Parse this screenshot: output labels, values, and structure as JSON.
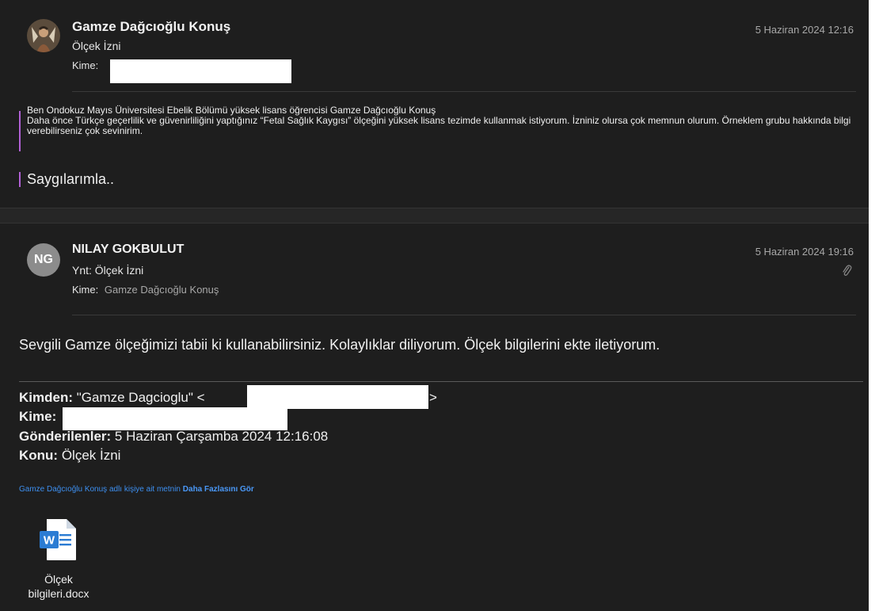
{
  "message1": {
    "sender": "Gamze Dağcıoğlu Konuş",
    "subject": "Ölçek İzni",
    "to_label": "Kime:",
    "date": "5 Haziran 2024 12:16",
    "body_lines": [
      "Ben Ondokuz Mayıs Üniversitesi Ebelik Bölümü yüksek lisans öğrencisi Gamze Dağcıoğlu Konuş",
      "Daha önce Türkçe geçerlilik ve güvenirliliğini yaptığınız  “Fetal Sağlık Kaygısı” ölçeğini yüksek lisans tezimde kullanmak istiyorum. İzniniz olursa çok memnun olurum. Örneklem grubu hakkında bilgi verebilirseniz çok sevinirim."
    ],
    "signoff": "Saygılarımla.."
  },
  "message2": {
    "avatar_initials": "NG",
    "sender": "NILAY GOKBULUT",
    "subject": "Ynt: Ölçek İzni",
    "to_label": "Kime:",
    "to_name": "Gamze Dağcıoğlu Konuş",
    "date": "5 Haziran 2024 19:16",
    "body": "Sevgili Gamze ölçeğimizi tabii ki kullanabilirsiniz. Kolaylıklar diliyorum. Ölçek bilgilerini ekte iletiyorum.",
    "forwarded": {
      "from_label": "Kimden:",
      "from_name": "\"Gamze Dagcioglu\" <",
      "from_close": ">",
      "to_label": "Kime:",
      "sent_label": "Gönderilenler:",
      "sent_value": "5 Haziran Çarşamba 2024 12:16:08",
      "subject_label": "Konu:",
      "subject_value": "Ölçek İzni"
    },
    "more_text": "Gamze Dağcıoğlu Konuş adlı kişiye ait metnin",
    "more_link": "Daha Fazlasını Gör",
    "attachment": {
      "line1": "Ölçek",
      "line2": "bilgileri.docx",
      "icon": "word-document-icon"
    }
  },
  "colors": {
    "background": "#1e1e1e",
    "quote_bar": "#b261d6",
    "link": "#3d8ff0",
    "word_blue": "#2b7cd3"
  }
}
